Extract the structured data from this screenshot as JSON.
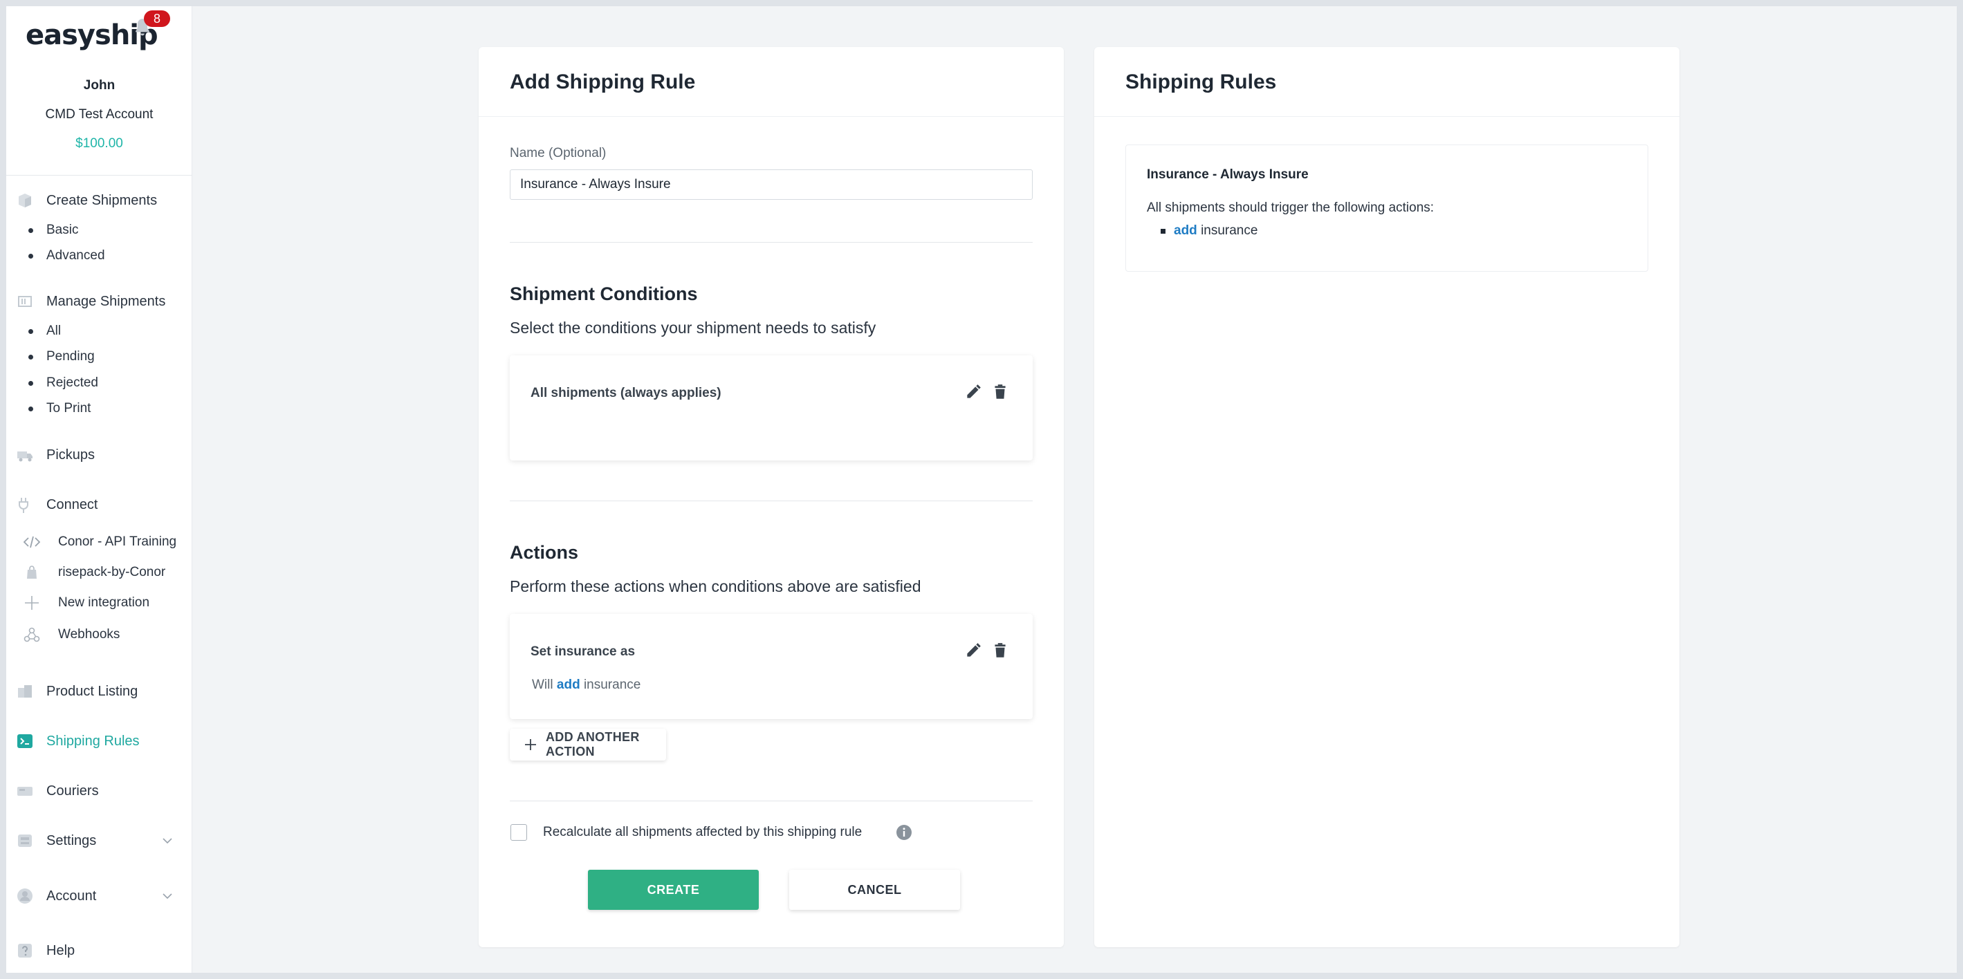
{
  "brand": {
    "logo": "easyship",
    "notification_count": "8"
  },
  "user": {
    "name": "John",
    "account": "CMD Test Account",
    "balance": "$100.00"
  },
  "sidebar": {
    "create_shipments": "Create Shipments",
    "create_sub": [
      "Basic",
      "Advanced"
    ],
    "manage_shipments": "Manage Shipments",
    "manage_sub": [
      "All",
      "Pending",
      "Rejected",
      "To Print"
    ],
    "pickups": "Pickups",
    "connect": "Connect",
    "integrations": [
      "Conor - API Training",
      "risepack-by-Conor",
      "New integration",
      "Webhooks"
    ],
    "product_listing": "Product Listing",
    "shipping_rules": "Shipping Rules",
    "couriers": "Couriers",
    "settings": "Settings",
    "account": "Account",
    "help": "Help",
    "active_color": "#1fa8a0"
  },
  "form": {
    "title": "Add Shipping Rule",
    "name_label": "Name (Optional)",
    "name_value": "Insurance - Always Insure",
    "conditions_title": "Shipment Conditions",
    "conditions_subtitle": "Select the conditions your shipment needs to satisfy",
    "condition_item": "All shipments (always applies)",
    "actions_title": "Actions",
    "actions_subtitle": "Perform these actions when conditions above are satisfied",
    "action_item": "Set insurance as",
    "action_desc_prefix": "Will",
    "action_desc_verb": "add",
    "action_desc_suffix": "insurance",
    "add_action_label": "ADD ANOTHER ACTION",
    "recalc_label": "Recalculate all shipments affected by this shipping rule",
    "create_label": "CREATE",
    "cancel_label": "CANCEL",
    "create_color": "#2fb084"
  },
  "rules_panel": {
    "title": "Shipping Rules",
    "rule_name": "Insurance - Always Insure",
    "rule_desc": "All shipments should trigger the following actions:",
    "rule_action_verb": "add",
    "rule_action_suffix": "insurance",
    "link_color": "#1f7cc4"
  }
}
